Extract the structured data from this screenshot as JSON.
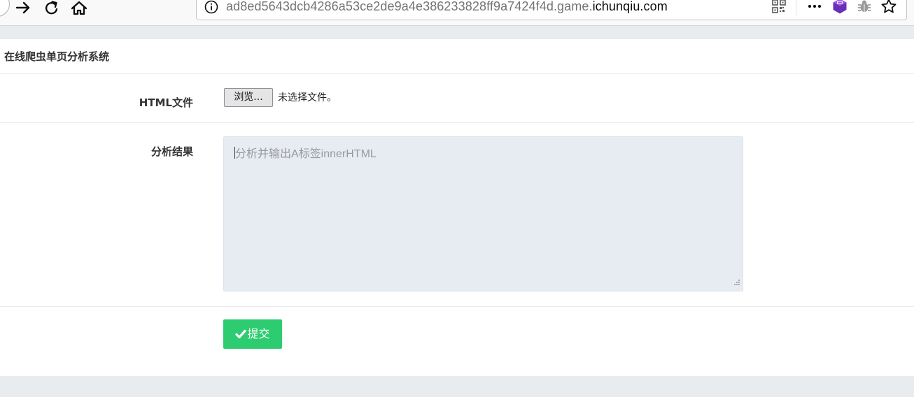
{
  "browser": {
    "url_prefix": "ad8ed5643dcb4286a53ce2de9a4e386233828ff9a7424f4d.game.",
    "url_host": "ichunqiu.com",
    "icons": [
      "back-icon",
      "forward-icon",
      "reload-icon",
      "home-icon",
      "info-icon",
      "qr-code-icon",
      "more-icon",
      "extension-icon",
      "bug-icon",
      "bookmark-star-icon"
    ]
  },
  "page": {
    "title": "在线爬虫单页分析系统",
    "form": {
      "file_label": "HTML文件",
      "browse_label": "浏览...",
      "file_status": "未选择文件。",
      "result_label": "分析结果",
      "result_placeholder": "分析并输出A标签innerHTML",
      "submit_label": "提交"
    }
  },
  "colors": {
    "accent": "#2ecc71",
    "page_background": "#e9ecef",
    "textarea_background": "#e7ebf2"
  }
}
